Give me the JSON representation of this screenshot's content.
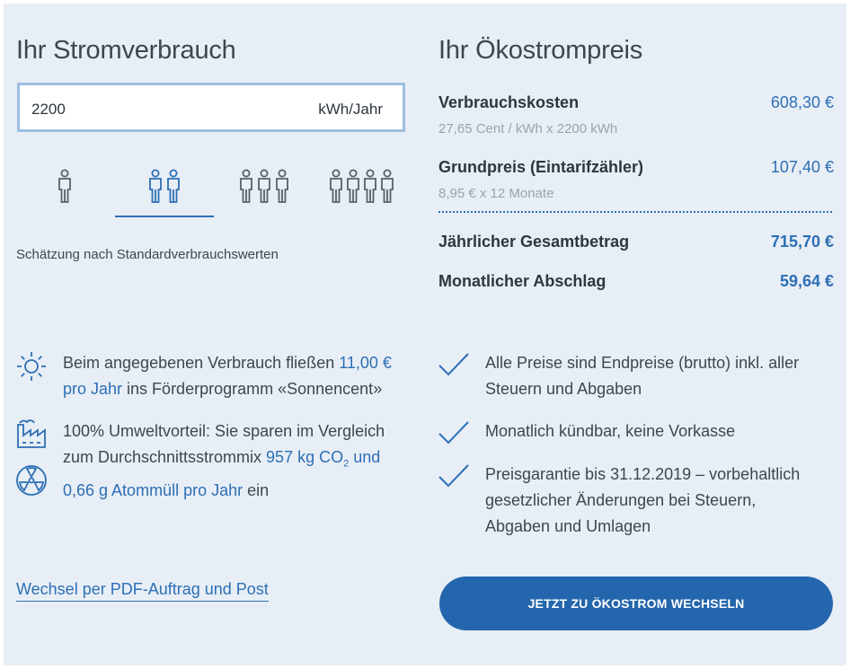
{
  "left": {
    "title": "Ihr Stromverbrauch",
    "input_value": "2200",
    "input_unit": "kWh/Jahr",
    "household_options": [
      {
        "persons": 1,
        "selected": false
      },
      {
        "persons": 2,
        "selected": true
      },
      {
        "persons": 3,
        "selected": false
      },
      {
        "persons": 4,
        "selected": false
      }
    ],
    "estimate_note": "Schätzung nach Standardverbrauchswerten",
    "info1_a": "Beim angegebenen Verbrauch fließen ",
    "info1_link": "11,00 €",
    "info1_b": "pro Jahr",
    "info1_c": " ins Förderprogramm «Sonnencent»",
    "info2_line1": "100% Umweltvorteil: Sie sparen im Vergleich",
    "info2_line2_a": "zum Durchschnittsstrommix ",
    "info2_link1": "957 kg CO",
    "info2_sub": "2",
    "info2_link2": " und",
    "info2_line3_link": "0,66 g Atommüll pro Jahr",
    "info2_line3_b": " ein",
    "pdf_link": "Wechsel per PDF-Auftrag und Post"
  },
  "right": {
    "title": "Ihr Ökostrompreis",
    "rows": [
      {
        "label": "Verbrauchskosten",
        "sub": "27,65 Cent / kWh x 2200 kWh",
        "value": "608,30 €"
      },
      {
        "label": "Grundpreis (Eintarifzähler)",
        "sub": "8,95 € x 12 Monate",
        "value": "107,40 €"
      }
    ],
    "totals": [
      {
        "label": "Jährlicher Gesamtbetrag",
        "value": "715,70 €"
      },
      {
        "label": "Monatlicher Abschlag",
        "value": "59,64 €"
      }
    ],
    "checks": [
      {
        "line1": "Alle Preise sind Endpreise (brutto) inkl. aller",
        "line2": "Steuern und Abgaben",
        "line3": ""
      },
      {
        "line1": "Monatlich kündbar, keine Vorkasse",
        "line2": "",
        "line3": ""
      },
      {
        "line1": "Preisgarantie bis 31.12.2019 – vorbehaltlich",
        "line2": "gesetzlicher Änderungen bei Steuern,",
        "line3": "Abgaben und Umlagen"
      }
    ],
    "cta": "JETZT ZU ÖKOSTROM WECHSELN"
  },
  "colors": {
    "accent": "#2c6fb5",
    "button": "#2466ad",
    "panel": "#e8eef6"
  },
  "icons": [
    "person-icon",
    "sun-icon",
    "factory-icon",
    "radiation-icon",
    "checkmark-icon"
  ]
}
